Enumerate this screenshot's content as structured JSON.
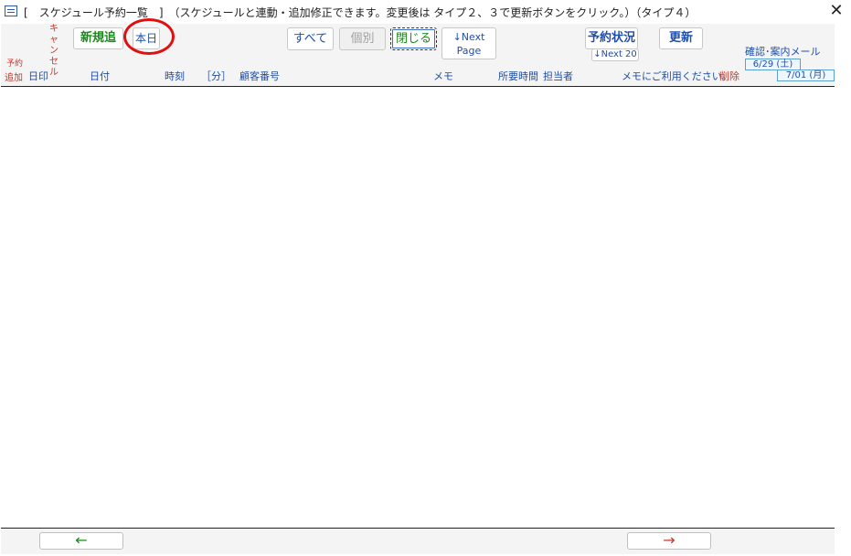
{
  "window": {
    "title": "[　スケジュール予約一覧　]　（スケジュールと連動・追加修正できます。変更後は タイプ２、３で更新ボタンをクリック。）（タイプ４）",
    "close_label": "✕"
  },
  "toolbar": {
    "new_label": "新規追加",
    "today_label": "本日",
    "all_label": "すべて",
    "individual_label": "個別",
    "close_label": "閉じる",
    "next_page_label_1": "↓Next",
    "next_page_label_2": "Page",
    "reservation_status_label": "予約状況",
    "next20_label": "↓Next 20",
    "refresh_label": "更新"
  },
  "mail": {
    "label": "確認･案内メール",
    "date1": "6/29 (土)",
    "date2": "7/01 (月)"
  },
  "columns": {
    "yoyaku_line1": "予約",
    "yoyaku_line2": "追加",
    "inkan": "日印",
    "cancel": "キャンセル",
    "date": "日付",
    "time": "時刻",
    "minutes": "［分］",
    "customer_no": "顧客番号",
    "memo": "メモ",
    "duration": "所要時間",
    "staff": "担当者",
    "memo_use": "メモにご利用ください。",
    "delete": "削除"
  },
  "footer": {
    "prev_arrow": "←",
    "next_arrow": "→"
  },
  "colors": {
    "green": "#1a8a1a",
    "blue": "#1f4fa8",
    "red": "#c0392b",
    "annotation": "#e01010"
  }
}
